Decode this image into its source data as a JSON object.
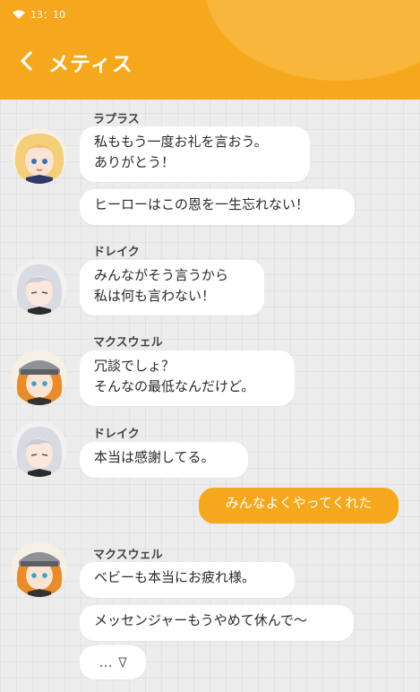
{
  "status_bar": {
    "time": "13：10"
  },
  "header": {
    "title": "メティス",
    "back_icon": "chevron-left-icon"
  },
  "colors": {
    "accent": "#f6a81c",
    "bubble": "#ffffff",
    "background": "#ececec"
  },
  "messages": [
    {
      "sender": "ラプラス",
      "lines": [
        "私ももう一度お礼を言おう。\nありがとう！",
        "ヒーローはこの恩を一生忘れない！"
      ]
    },
    {
      "sender": "ドレイク",
      "lines": [
        "みんながそう言うから\n私は何も言わない！"
      ]
    },
    {
      "sender": "マクスウェル",
      "lines": [
        "冗談でしょ？\nそんなの最低なんだけど。"
      ]
    },
    {
      "sender": "ドレイク",
      "lines": [
        "本当は感謝してる。"
      ]
    },
    {
      "self": "みんなよくやってくれた"
    },
    {
      "sender": "マクスウェル",
      "lines": [
        "ベビーも本当にお疲れ様。",
        "メッセンジャーもうやめて休んで～"
      ],
      "typing": "…"
    }
  ]
}
